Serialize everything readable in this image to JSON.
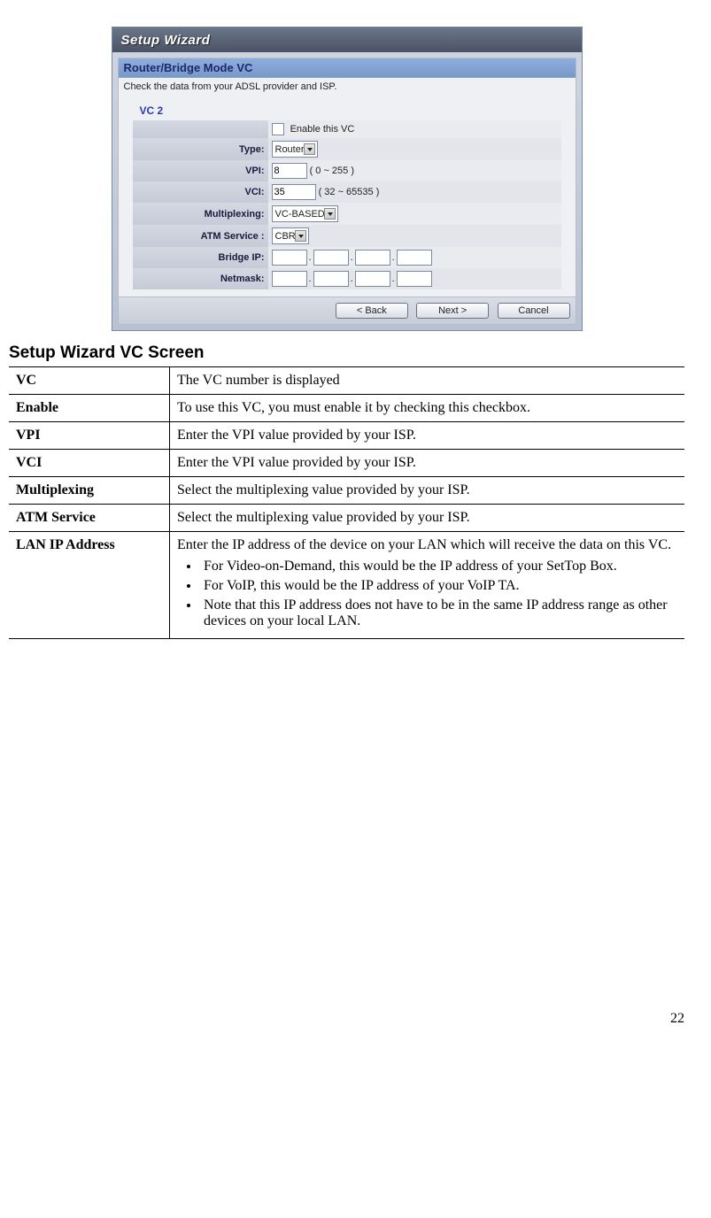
{
  "wizard": {
    "title": "Setup Wizard",
    "section": "Router/Bridge Mode VC",
    "help": "Check the data from your ADSL provider and ISP.",
    "vc_label": "VC 2",
    "rows": {
      "enable_label": "Enable this VC",
      "type_label": "Type:",
      "type_value": "Router",
      "vpi_label": "VPI:",
      "vpi_value": "8",
      "vpi_hint": "( 0 ~ 255 )",
      "vci_label": "VCI:",
      "vci_value": "35",
      "vci_hint": "( 32 ~ 65535 )",
      "mux_label": "Multiplexing:",
      "mux_value": "VC-BASED",
      "atm_label": "ATM Service :",
      "atm_value": "CBR",
      "bridge_label": "Bridge IP:",
      "netmask_label": "Netmask:"
    },
    "buttons": {
      "back": "< Back",
      "next": "Next >",
      "cancel": "Cancel"
    }
  },
  "doc": {
    "heading": "Setup Wizard VC Screen",
    "rows": [
      {
        "k": "VC",
        "v": "The VC number is displayed"
      },
      {
        "k": "Enable",
        "v": "To use this VC, you must enable it by checking this checkbox."
      },
      {
        "k": "VPI",
        "v": "Enter the VPI value provided by your ISP."
      },
      {
        "k": "VCI",
        "v": "Enter the VPI value provided by your ISP."
      },
      {
        "k": "Multiplexing",
        "v": "Select the multiplexing value provided by your ISP."
      },
      {
        "k": "ATM Service",
        "v": "Select the multiplexing value provided by your ISP."
      }
    ],
    "lan_row": {
      "k": "LAN IP Address",
      "intro": "Enter the IP address of the device on your LAN which will receive the data on this VC.",
      "bullets": [
        "For Video-on-Demand, this would be the IP address of your SetTop Box.",
        "For VoIP, this would be the IP address of your VoIP TA.",
        "Note that this IP address does not have to be in the same IP address range as other devices on your local LAN."
      ]
    }
  },
  "page_number": "22"
}
